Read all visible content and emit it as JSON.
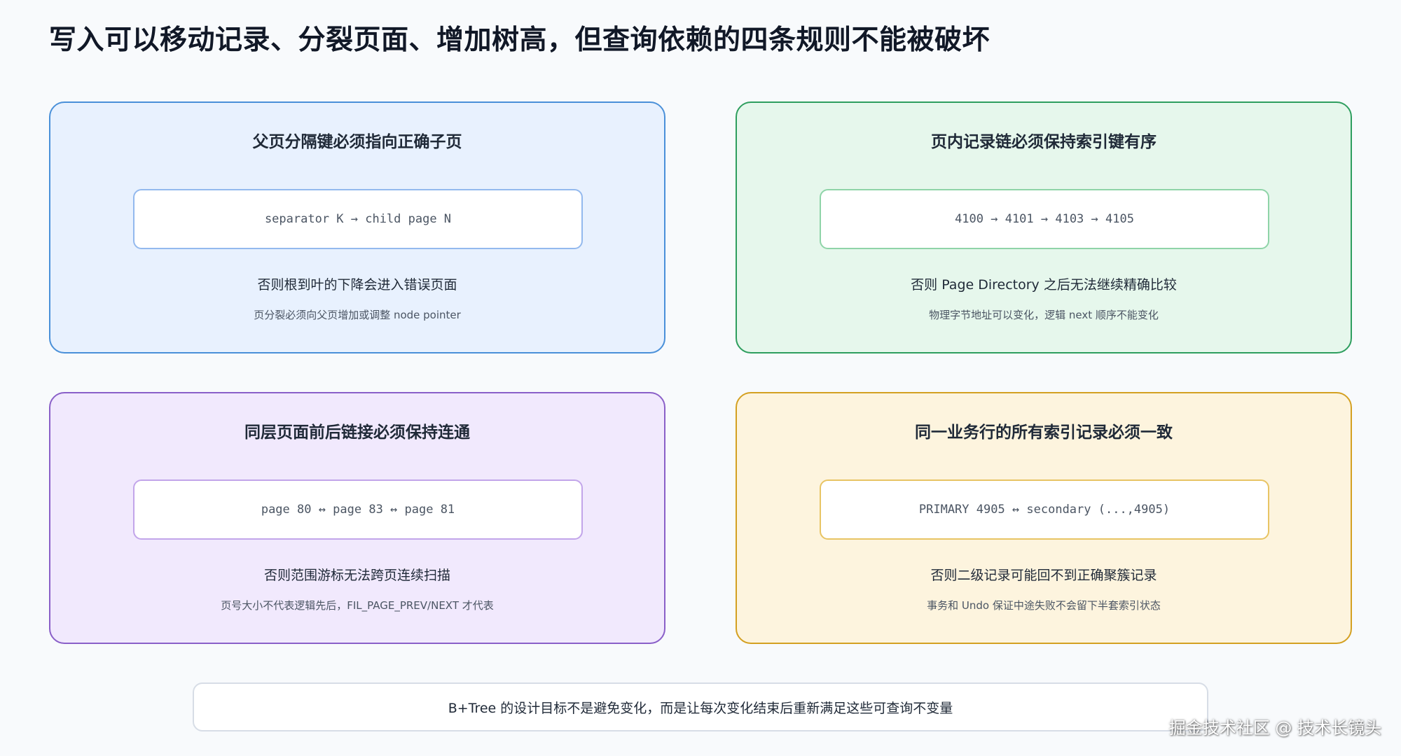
{
  "title": "写入可以移动记录、分裂页面、增加树高，但查询依赖的四条规则不能被破坏",
  "cards": [
    {
      "title": "父页分隔键必须指向正确子页",
      "code": "separator K → child page N",
      "consequence": "否则根到叶的下降会进入错误页面",
      "note": "页分裂必须向父页增加或调整 node pointer",
      "colors": {
        "background": "#e8f1fe",
        "border": "#4a90d9"
      }
    },
    {
      "title": "页内记录链必须保持索引键有序",
      "code": "4100 → 4101 → 4103 → 4105",
      "consequence": "否则 Page Directory 之后无法继续精确比较",
      "note": "物理字节地址可以变化，逻辑 next 顺序不能变化",
      "colors": {
        "background": "#e6f7ec",
        "border": "#2e9e5e"
      }
    },
    {
      "title": "同层页面前后链接必须保持连通",
      "code": "page 80 ↔ page 83 ↔ page 81",
      "consequence": "否则范围游标无法跨页连续扫描",
      "note": "页号大小不代表逻辑先后，FIL_PAGE_PREV/NEXT 才代表",
      "colors": {
        "background": "#f1e9fd",
        "border": "#8a5fc8"
      }
    },
    {
      "title": "同一业务行的所有索引记录必须一致",
      "code": "PRIMARY 4905 ↔ secondary (...,4905)",
      "consequence": "否则二级记录可能回不到正确聚簇记录",
      "note": "事务和 Undo 保证中途失败不会留下半套索引状态",
      "colors": {
        "background": "#fdf4de",
        "border": "#d4a021"
      }
    }
  ],
  "footer": "B+Tree 的设计目标不是避免变化，而是让每次变化结束后重新满足这些可查询不变量",
  "watermark": "掘金技术社区 @ 技术长镜头"
}
